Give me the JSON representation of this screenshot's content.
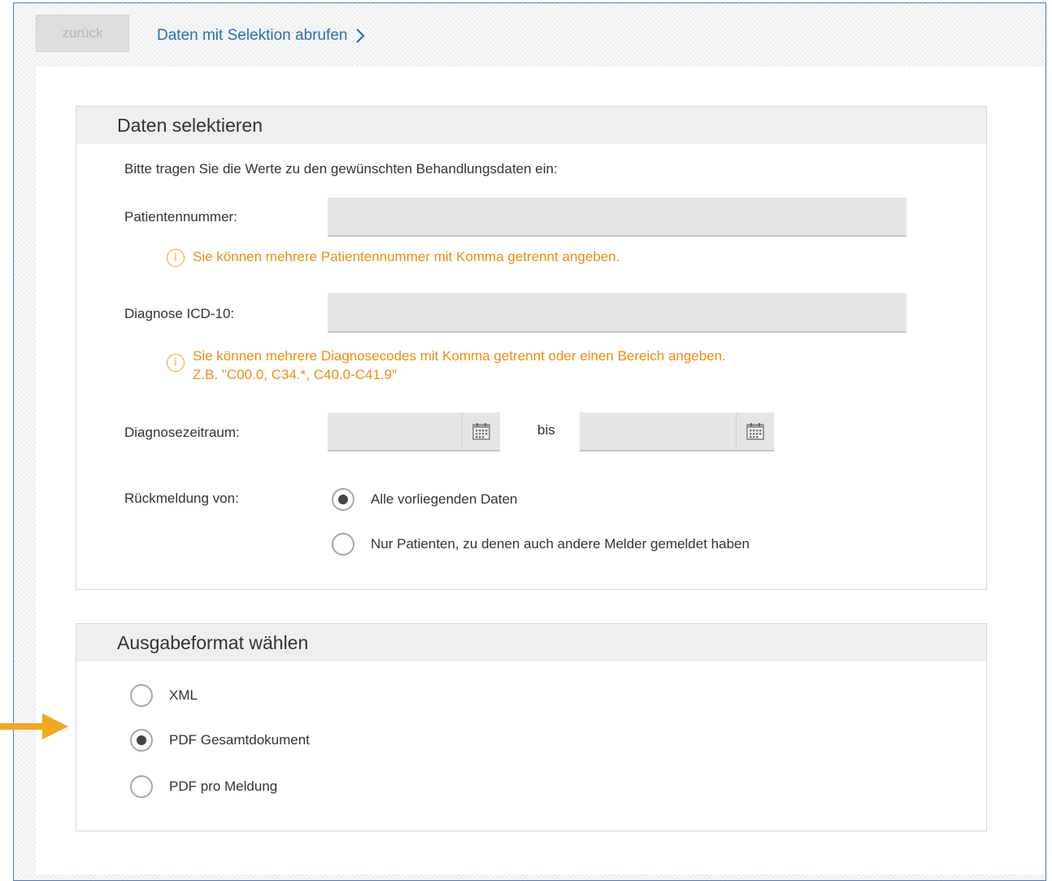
{
  "toolbar": {
    "back_label": "zurück",
    "fetch_label": "Daten mit Selektion abrufen"
  },
  "select_panel": {
    "title": "Daten selektieren",
    "intro": "Bitte tragen Sie die Werte zu den gewünschten Behandlungsdaten ein:",
    "patient_label": "Patientennummer:",
    "patient_value": "",
    "patient_hint": "Sie können mehrere Patientennummer mit Komma getrennt angeben.",
    "icd_label": "Diagnose ICD-10:",
    "icd_value": "",
    "icd_hint_line1": "Sie können mehrere Diagnosecodes mit Komma getrennt oder einen Bereich angeben.",
    "icd_hint_line2": "Z.B. \"C00.0, C34.*, C40.0-C41.9\"",
    "period_label": "Diagnosezeitraum:",
    "period_from": "",
    "period_between": "bis",
    "period_to": "",
    "feedback_label": "Rückmeldung von:",
    "feedback_options": [
      {
        "label": "Alle vorliegenden Daten",
        "checked": true
      },
      {
        "label": "Nur Patienten, zu denen auch andere Melder gemeldet haben",
        "checked": false
      }
    ]
  },
  "format_panel": {
    "title": "Ausgabeformat wählen",
    "options": [
      {
        "label": "XML",
        "checked": false
      },
      {
        "label": "PDF Gesamtdokument",
        "checked": true
      },
      {
        "label": "PDF pro Meldung",
        "checked": false
      }
    ]
  },
  "colors": {
    "accent_link": "#2f6fb0",
    "hint_orange": "#f08c12",
    "arrow": "#f2a81d",
    "frame_border": "#4a7cc9"
  },
  "icons": {
    "info": "info-icon",
    "calendar": "calendar-icon",
    "chevron": "chevron-right-icon",
    "annotation_arrow": "arrow-right-icon"
  }
}
